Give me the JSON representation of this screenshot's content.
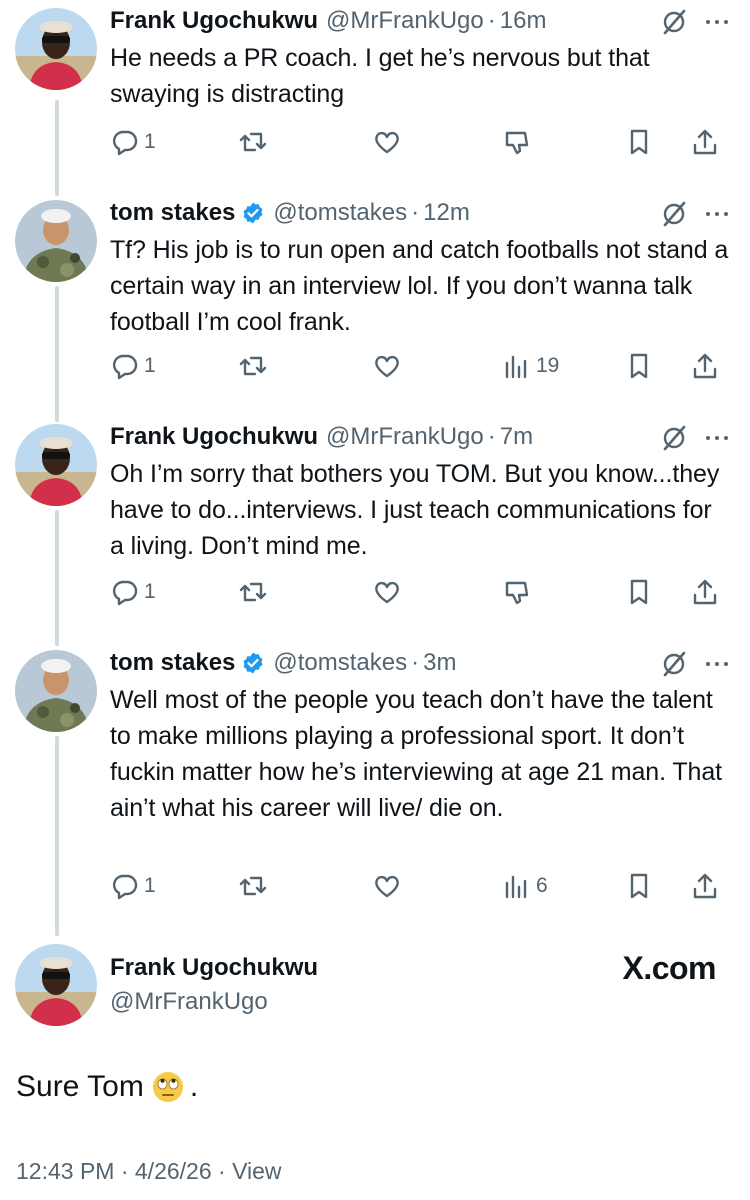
{
  "tweets": [
    {
      "name": "Frank Ugochukwu",
      "handle": "@MrFrankUgo",
      "time": "16m",
      "verified": false,
      "text": "He needs a PR coach. I get he’s nervous but that swaying is distracting",
      "reply_count": "1",
      "views": "",
      "avatar": "frank"
    },
    {
      "name": "tom stakes",
      "handle": "@tomstakes",
      "time": "12m",
      "verified": true,
      "text": "Tf? His job is to run open and catch footballs not stand a certain way in an interview lol. If you don’t wanna talk football I’m cool frank.",
      "reply_count": "1",
      "views": "19",
      "avatar": "tom"
    },
    {
      "name": "Frank Ugochukwu",
      "handle": "@MrFrankUgo",
      "time": "7m",
      "verified": false,
      "text": "Oh I’m sorry that bothers you TOM. But you know...they have to do...interviews. I just teach communications for a living. Don’t mind me.",
      "reply_count": "1",
      "views": "",
      "avatar": "frank"
    },
    {
      "name": "tom stakes",
      "handle": "@tomstakes",
      "time": "3m",
      "verified": true,
      "text": "Well most of the people you teach don’t have the talent to make millions playing a professional sport. It don’t fuckin matter how he’s interviewing at age 21 man. That ain’t what his career will live/ die on.",
      "reply_count": "1",
      "views": "6",
      "avatar": "tom"
    }
  ],
  "main": {
    "name": "Frank Ugochukwu",
    "handle": "@MrFrankUgo",
    "brand": "X.com",
    "text": "Sure Tom",
    "text_tail": ".",
    "emoji": "rolling-eyes-emoji",
    "meta": "12:43 PM · 4/26/26 · View"
  },
  "separator": "·",
  "colors": {
    "text": "#0f1419",
    "muted": "#536471",
    "verified": "#1d9bf0",
    "thread": "#cfd9de"
  }
}
